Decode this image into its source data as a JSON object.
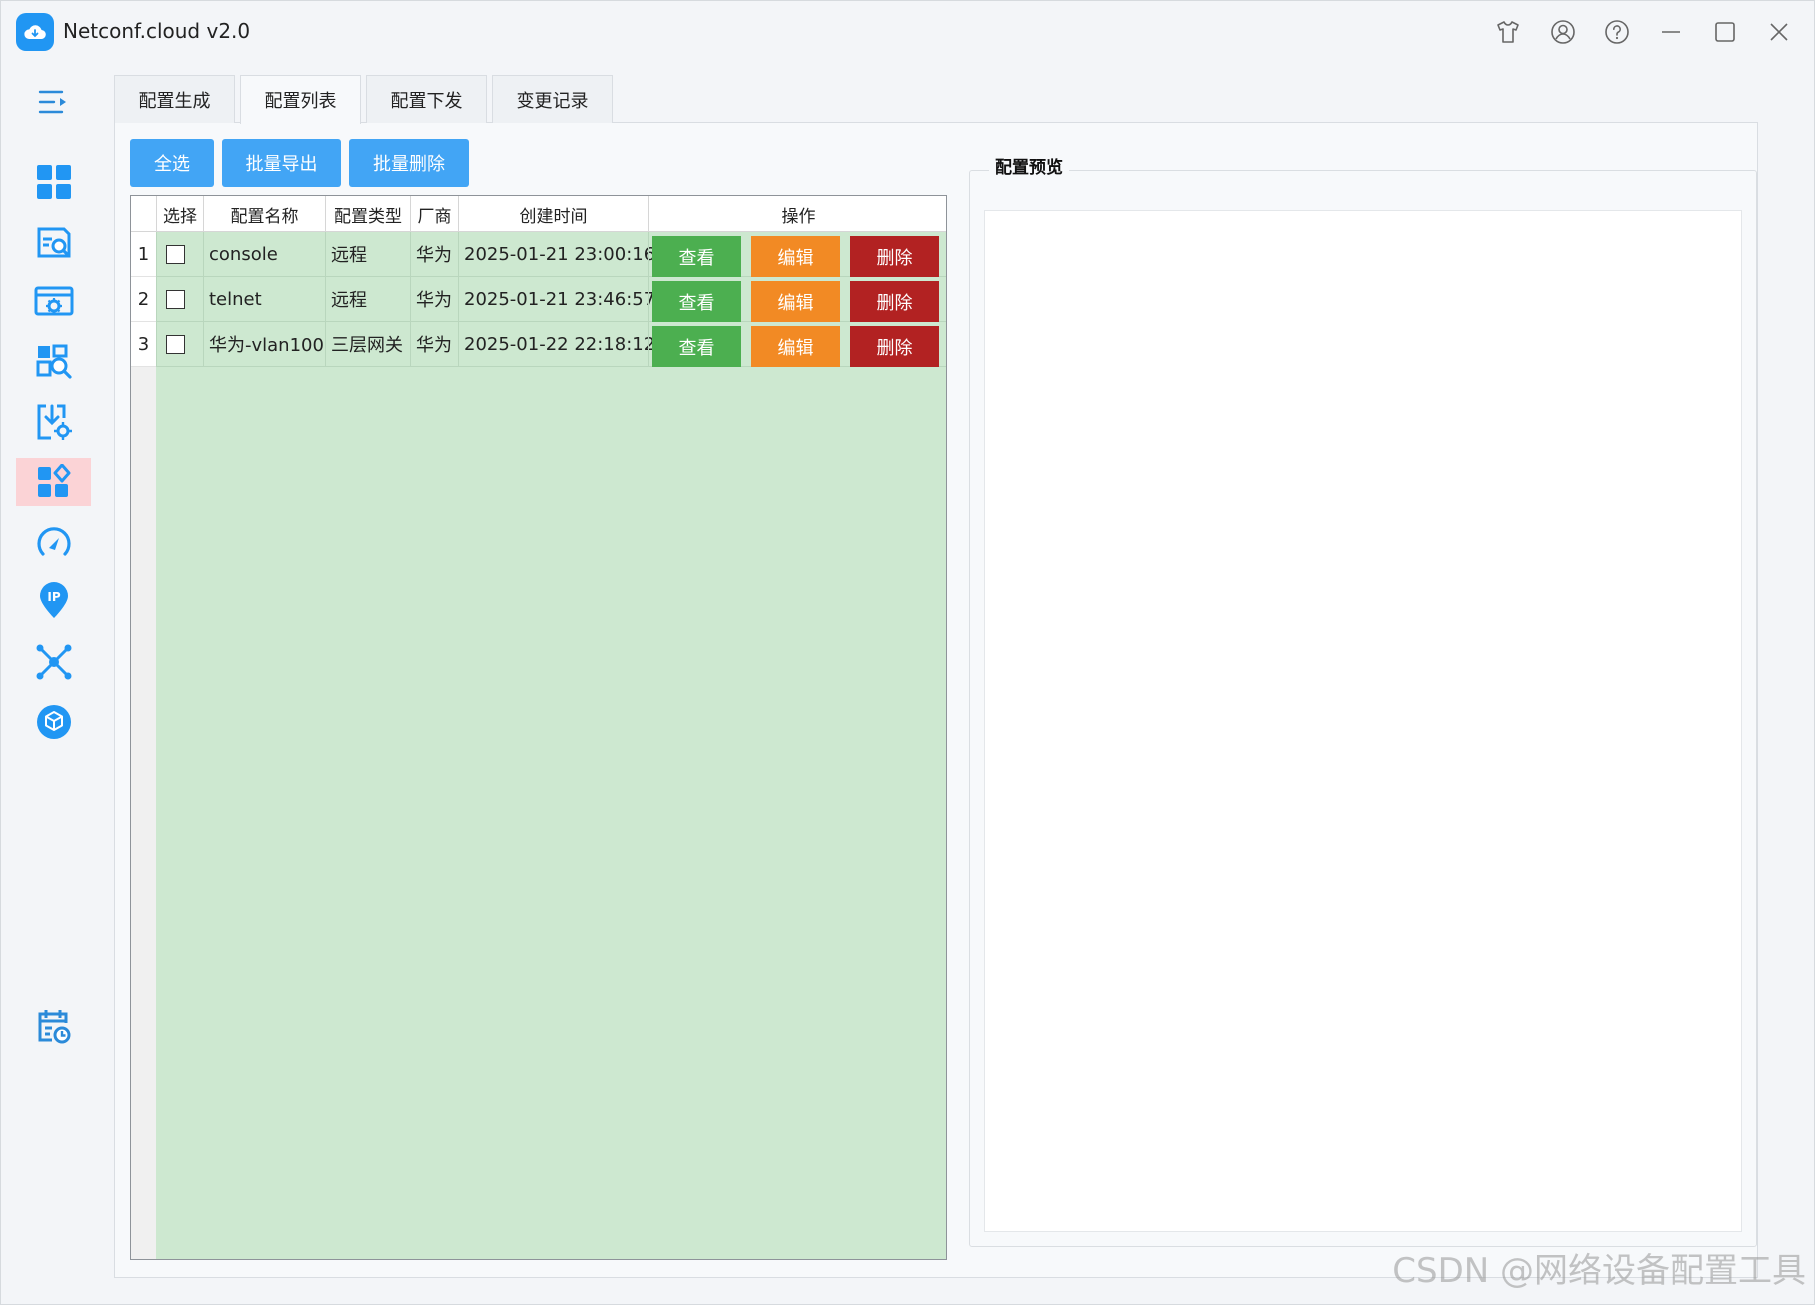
{
  "app": {
    "title": "Netconf.cloud v2.0"
  },
  "colors": {
    "accent": "#2196f3",
    "button_blue": "#42a5f5",
    "view_green": "#4caf50",
    "edit_orange": "#f28a24",
    "delete_red": "#b22222",
    "grid_bg": "#cde8d0",
    "active_nav": "#fbd3d6"
  },
  "title_bar_icons": [
    "shirt-icon",
    "user-icon",
    "help-icon",
    "minimize-icon",
    "maximize-icon",
    "close-icon"
  ],
  "sidebar": {
    "icons": [
      "dashboard-icon",
      "config-search-icon",
      "config-settings-icon",
      "search-grid-icon",
      "import-settings-icon",
      "apps-icon",
      "speed-gauge-icon",
      "ip-location-icon",
      "topology-icon",
      "package-icon"
    ],
    "active_index": 5,
    "bottom_icon": "calendar-clock-icon"
  },
  "tabs": [
    {
      "label": "配置生成"
    },
    {
      "label": "配置列表"
    },
    {
      "label": "配置下发"
    },
    {
      "label": "变更记录"
    }
  ],
  "active_tab": 1,
  "toolbar": {
    "select_all": "全选",
    "batch_export": "批量导出",
    "batch_delete": "批量删除"
  },
  "table": {
    "columns": [
      "选择",
      "配置名称",
      "配置类型",
      "厂商",
      "创建时间",
      "操作"
    ],
    "rows": [
      {
        "index": "1",
        "name": "console",
        "type": "远程",
        "vendor": "华为",
        "created": "2025-01-21 23:00:16"
      },
      {
        "index": "2",
        "name": "telnet",
        "type": "远程",
        "vendor": "华为",
        "created": "2025-01-21 23:46:57"
      },
      {
        "index": "3",
        "name": "华为-vlan100",
        "type": "三层网关",
        "vendor": "华为",
        "created": "2025-01-22 22:18:12"
      }
    ],
    "actions": {
      "view": "查看",
      "edit": "编辑",
      "delete": "删除"
    }
  },
  "preview": {
    "title": "配置预览"
  },
  "watermark": "CSDN @网络设备配置工具"
}
